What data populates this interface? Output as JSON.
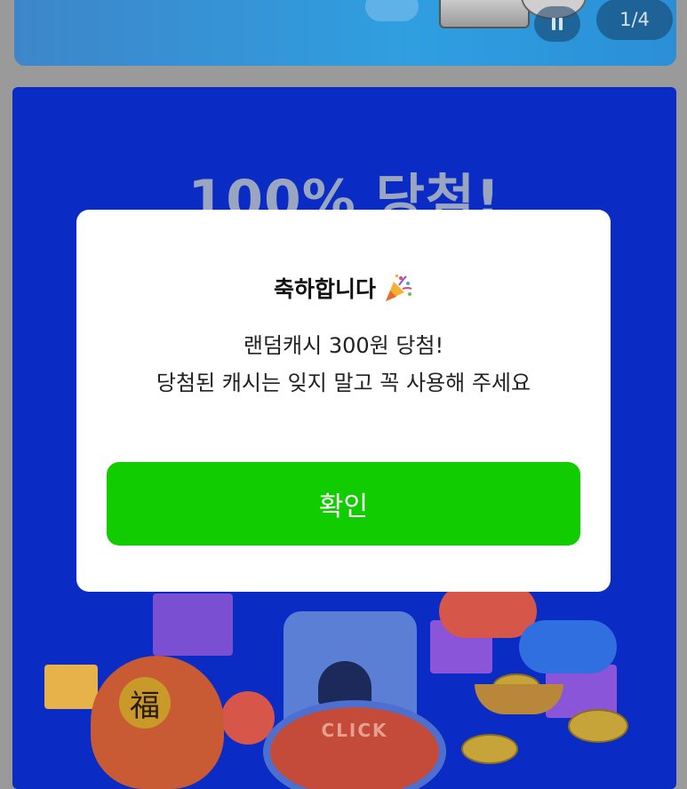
{
  "banner": {
    "pager_text": "1/4",
    "pause_icon": "pause-icon"
  },
  "promo": {
    "title": "100% 당첨!",
    "luck_character": "福",
    "click_label": "CLICK"
  },
  "dialog": {
    "title": "축하합니다",
    "title_icon": "party-popper-icon",
    "message_line1": "랜덤캐시 300원 당첨!",
    "message_line2": "당첨된 캐시는 잊지 말고 꼭 사용해 주세요",
    "confirm_label": "확인"
  },
  "colors": {
    "confirm_button": "#11cd00",
    "promo_background": "#0a2cc4",
    "banner_background": "#2f9fe0"
  }
}
